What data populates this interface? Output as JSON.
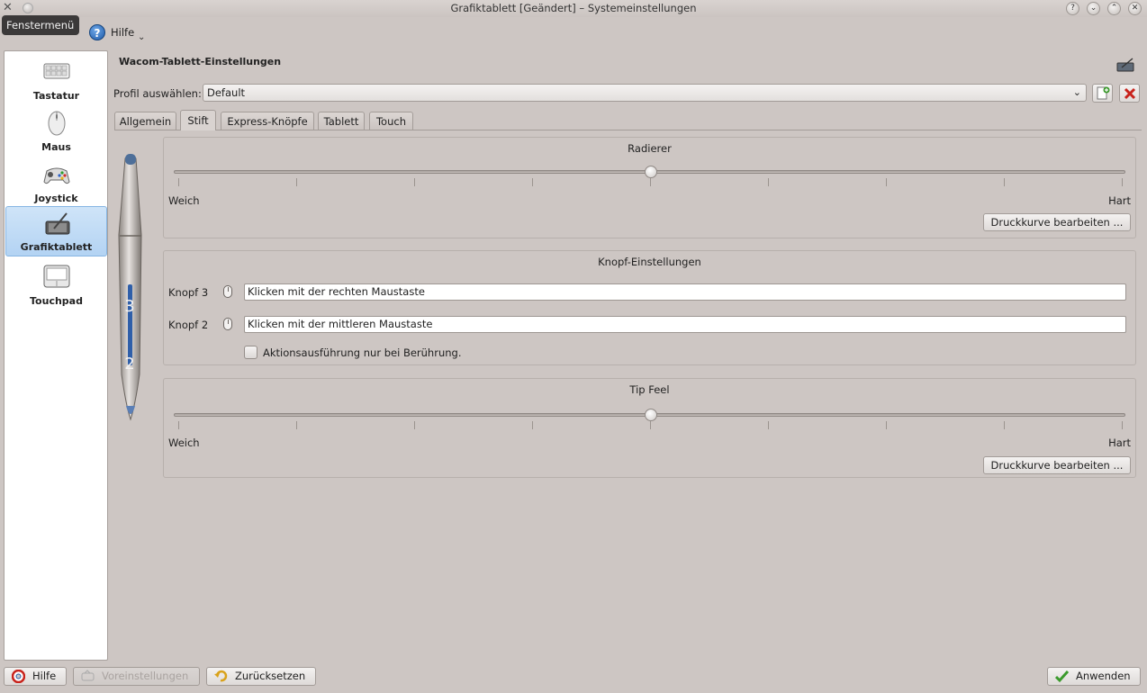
{
  "window": {
    "title": "Grafiktablett [Geändert] – Systemeinstellungen",
    "tooltip": "Fenstermenü",
    "buttons": {
      "help": "?",
      "minimize": "⌄",
      "maximize": "⌃",
      "close": "✕"
    }
  },
  "menu": {
    "help_label": "Hilfe"
  },
  "sidebar": {
    "items": [
      {
        "label": "Tastatur",
        "icon": "keyboard-icon",
        "active": false
      },
      {
        "label": "Maus",
        "icon": "mouse-icon",
        "active": false
      },
      {
        "label": "Joystick",
        "icon": "gamepad-icon",
        "active": false
      },
      {
        "label": "Grafiktablett",
        "icon": "graphics-tablet-icon",
        "active": true
      },
      {
        "label": "Touchpad",
        "icon": "touchpad-icon",
        "active": false
      }
    ]
  },
  "header": {
    "title": "Wacom-Tablett-Einstellungen"
  },
  "profile": {
    "label": "Profil auswählen:",
    "value": "Default"
  },
  "tabs": [
    "Allgemein",
    "Stift",
    "Express-Knöpfe",
    "Tablett",
    "Touch"
  ],
  "active_tab": "Stift",
  "pen": {
    "button_upper": "3",
    "button_lower": "2"
  },
  "eraser": {
    "title": "Radierer",
    "min_label": "Weich",
    "max_label": "Hart",
    "level": 0.5,
    "button": "Druckkurve bearbeiten ..."
  },
  "buttons_group": {
    "title": "Knopf-Einstellungen",
    "rows": [
      {
        "label": "Knopf 3",
        "value": "Klicken mit der rechten Maustaste"
      },
      {
        "label": "Knopf 2",
        "value": "Klicken mit der mittleren Maustaste"
      }
    ],
    "checkbox_label": "Aktionsausführung nur bei Berührung.",
    "checkbox_checked": false
  },
  "tip_feel": {
    "title": "Tip Feel",
    "min_label": "Weich",
    "max_label": "Hart",
    "level": 0.5,
    "button": "Druckkurve bearbeiten ..."
  },
  "footer": {
    "help": "Hilfe",
    "defaults": "Voreinstellungen",
    "reset": "Zurücksetzen",
    "apply": "Anwenden"
  },
  "colors": {
    "background": "#cdc6c3",
    "selection": "#b3d3f3",
    "accent_blue": "#1e5aa8",
    "delete_red": "#c8231c",
    "apply_green": "#3b9a2c"
  }
}
